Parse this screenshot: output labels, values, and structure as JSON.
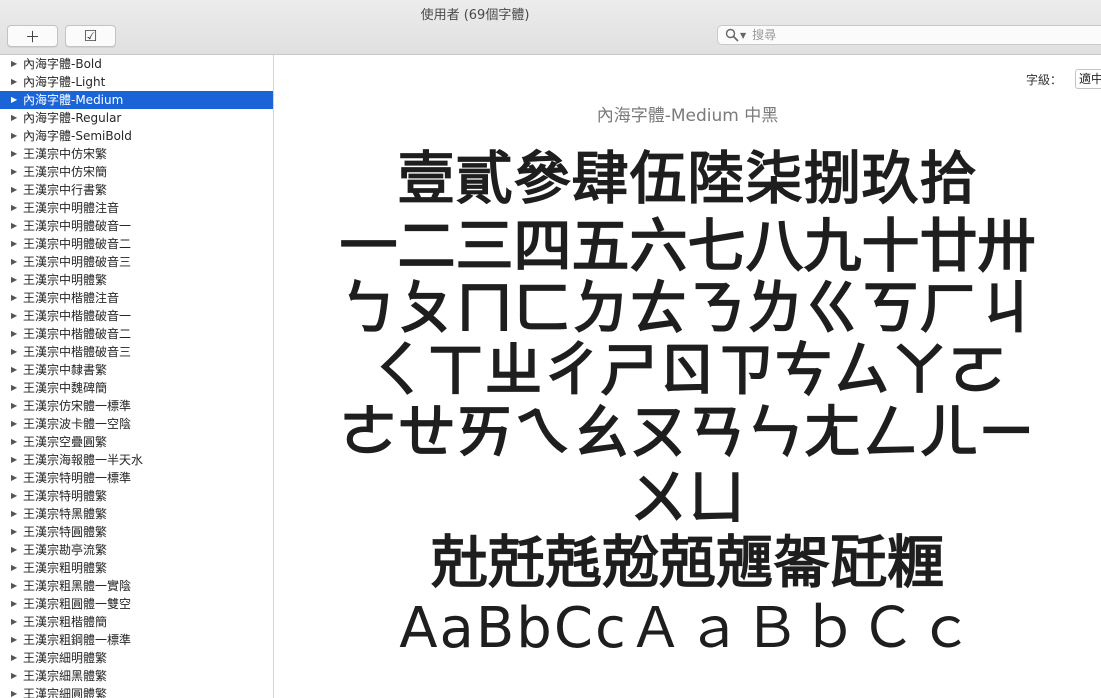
{
  "window": {
    "title": "使用者 (69個字體)"
  },
  "toolbar": {
    "add_label": "＋",
    "validate_label": "☑"
  },
  "search": {
    "placeholder": "搜尋",
    "value": ""
  },
  "sidebar": {
    "items": [
      {
        "label": "內海字體-Bold",
        "selected": false
      },
      {
        "label": "內海字體-Light",
        "selected": false
      },
      {
        "label": "內海字體-Medium",
        "selected": true
      },
      {
        "label": "內海字體-Regular",
        "selected": false
      },
      {
        "label": "內海字體-SemiBold",
        "selected": false
      },
      {
        "label": "王漢宗中仿宋繁",
        "selected": false
      },
      {
        "label": "王漢宗中仿宋簡",
        "selected": false
      },
      {
        "label": "王漢宗中行書繁",
        "selected": false
      },
      {
        "label": "王漢宗中明體注音",
        "selected": false
      },
      {
        "label": "王漢宗中明體破音一",
        "selected": false
      },
      {
        "label": "王漢宗中明體破音二",
        "selected": false
      },
      {
        "label": "王漢宗中明體破音三",
        "selected": false
      },
      {
        "label": "王漢宗中明體繁",
        "selected": false
      },
      {
        "label": "王漢宗中楷體注音",
        "selected": false
      },
      {
        "label": "王漢宗中楷體破音一",
        "selected": false
      },
      {
        "label": "王漢宗中楷體破音二",
        "selected": false
      },
      {
        "label": "王漢宗中楷體破音三",
        "selected": false
      },
      {
        "label": "王漢宗中隸書繁",
        "selected": false
      },
      {
        "label": "王漢宗中魏碑簡",
        "selected": false
      },
      {
        "label": "王漢宗仿宋體一標準",
        "selected": false
      },
      {
        "label": "王漢宗波卡體一空陰",
        "selected": false
      },
      {
        "label": "王漢宗空疊圓繁",
        "selected": false
      },
      {
        "label": "王漢宗海報體一半天水",
        "selected": false
      },
      {
        "label": "王漢宗特明體一標準",
        "selected": false
      },
      {
        "label": "王漢宗特明體繁",
        "selected": false
      },
      {
        "label": "王漢宗特黑體繁",
        "selected": false
      },
      {
        "label": "王漢宗特圓體繁",
        "selected": false
      },
      {
        "label": "王漢宗勘亭流繁",
        "selected": false
      },
      {
        "label": "王漢宗粗明體繁",
        "selected": false
      },
      {
        "label": "王漢宗粗黑體一實陰",
        "selected": false
      },
      {
        "label": "王漢宗粗圓體一雙空",
        "selected": false
      },
      {
        "label": "王漢宗粗楷體簡",
        "selected": false
      },
      {
        "label": "王漢宗粗鋼體一標準",
        "selected": false
      },
      {
        "label": "王漢宗細明體繁",
        "selected": false
      },
      {
        "label": "王漢宗細黑體繁",
        "selected": false
      },
      {
        "label": "王漢宗細圓體繁",
        "selected": false
      }
    ]
  },
  "preview": {
    "size_label": "字級：",
    "size_value": "適中",
    "font_name": "內海字體-Medium 中黑",
    "lines": [
      "壹貳參肆伍陸柒捌玖拾",
      "一二三四五六七八九十廿卅",
      "ㄅㄆㄇㄈㄉㄊㄋㄌㄍㄎㄏㄐ",
      "ㄑㄒㄓㄔㄕㄖㄗㄘㄙㄚㄛ",
      "ㄜㄝㄞㄟㄠㄡㄢㄣㄤㄥㄦㄧ",
      "ㄨㄩ",
      "兙兛兞兝兡兣嗧瓩糎",
      "AaBbCcＡａＢｂＣｃ"
    ]
  },
  "colors": {
    "selection": "#1a64d8",
    "background": "#ffffff"
  }
}
